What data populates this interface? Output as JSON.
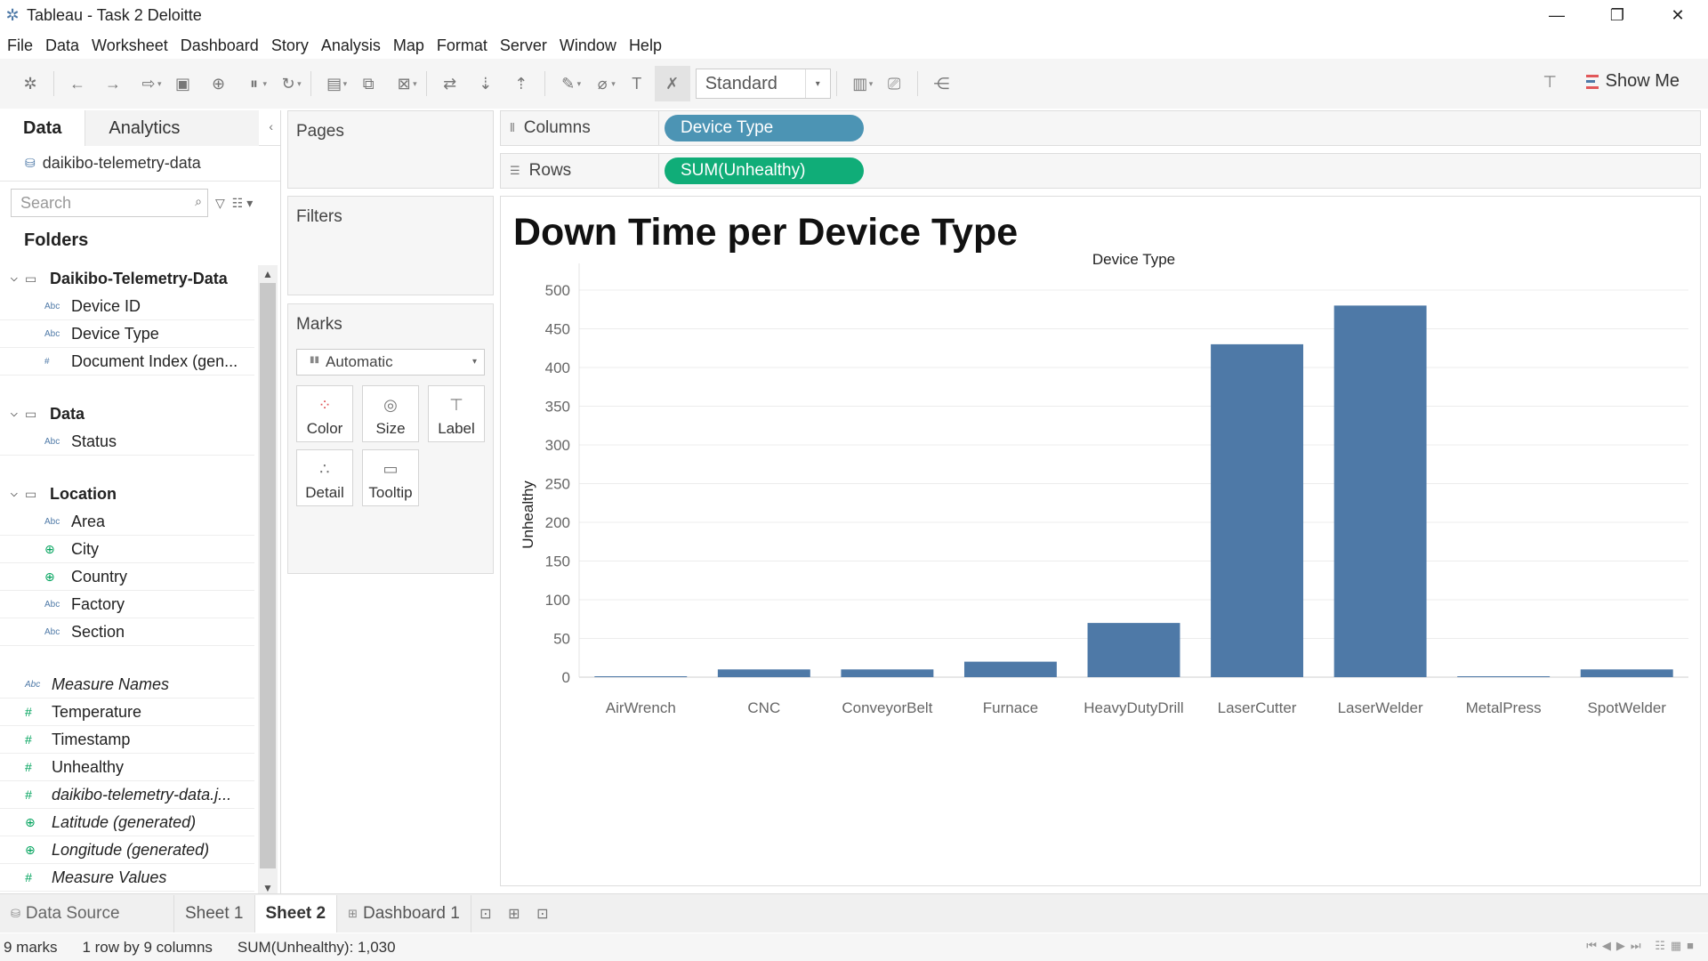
{
  "window": {
    "title": "Tableau - Task 2 Deloitte",
    "minimize": "—",
    "restore": "❐",
    "close": "✕"
  },
  "menu": [
    "File",
    "Data",
    "Worksheet",
    "Dashboard",
    "Story",
    "Analysis",
    "Map",
    "Format",
    "Server",
    "Window",
    "Help"
  ],
  "toolbar": {
    "fit_select": "Standard",
    "show_me": "Show Me"
  },
  "data_pane": {
    "tab_data": "Data",
    "tab_analytics": "Analytics",
    "datasource": "daikibo-telemetry-data",
    "search_placeholder": "Search",
    "folders_label": "Folders",
    "folders": [
      {
        "name": "Daikibo-Telemetry-Data",
        "fields": [
          {
            "name": "Device ID",
            "type": "Abc"
          },
          {
            "name": "Device Type",
            "type": "Abc"
          },
          {
            "name": "Document Index (gen...",
            "type": "#"
          }
        ]
      },
      {
        "name": "Data",
        "fields": [
          {
            "name": "Status",
            "type": "Abc"
          }
        ]
      },
      {
        "name": "Location",
        "fields": [
          {
            "name": "Area",
            "type": "Abc"
          },
          {
            "name": "City",
            "type": "geo"
          },
          {
            "name": "Country",
            "type": "geo"
          },
          {
            "name": "Factory",
            "type": "Abc"
          },
          {
            "name": "Section",
            "type": "Abc"
          }
        ]
      }
    ],
    "top_fields": [
      {
        "name": "Measure Names",
        "type": "Abc",
        "italic": true
      },
      {
        "name": "Temperature",
        "type": "#",
        "italic": false
      },
      {
        "name": "Timestamp",
        "type": "#",
        "italic": false
      },
      {
        "name": "Unhealthy",
        "type": "#",
        "italic": false
      },
      {
        "name": "daikibo-telemetry-data.j...",
        "type": "#",
        "italic": true
      },
      {
        "name": "Latitude (generated)",
        "type": "geo",
        "italic": true
      },
      {
        "name": "Longitude (generated)",
        "type": "geo",
        "italic": true
      },
      {
        "name": "Measure Values",
        "type": "#",
        "italic": true
      }
    ]
  },
  "cards": {
    "pages": "Pages",
    "filters": "Filters",
    "marks": "Marks",
    "marks_type": "Automatic",
    "mark_buttons": [
      "Color",
      "Size",
      "Label",
      "Detail",
      "Tooltip"
    ]
  },
  "shelves": {
    "columns_label": "Columns",
    "columns_pill": "Device Type",
    "rows_label": "Rows",
    "rows_pill": "SUM(Unhealthy)"
  },
  "view": {
    "title": "Down Time per Device Type"
  },
  "chart_data": {
    "type": "bar",
    "title": "Down Time per Device Type",
    "xlabel": "Device Type",
    "ylabel": "Unhealthy",
    "categories": [
      "AirWrench",
      "CNC",
      "ConveyorBelt",
      "Furnace",
      "HeavyDutyDrill",
      "LaserCutter",
      "LaserWelder",
      "MetalPress",
      "SpotWelder"
    ],
    "values": [
      1,
      10,
      10,
      20,
      70,
      430,
      480,
      1,
      10
    ],
    "ylim": [
      0,
      500
    ],
    "yticks": [
      0,
      50,
      100,
      150,
      200,
      250,
      300,
      350,
      400,
      450,
      500
    ],
    "bar_color": "#4e79a7",
    "grid": true
  },
  "tabs": {
    "data_source": "Data Source",
    "sheet1": "Sheet 1",
    "sheet2": "Sheet 2",
    "dashboard1": "Dashboard 1"
  },
  "status": {
    "marks": "9 marks",
    "dims": "1 row by 9 columns",
    "sum": "SUM(Unhealthy): 1,030"
  }
}
